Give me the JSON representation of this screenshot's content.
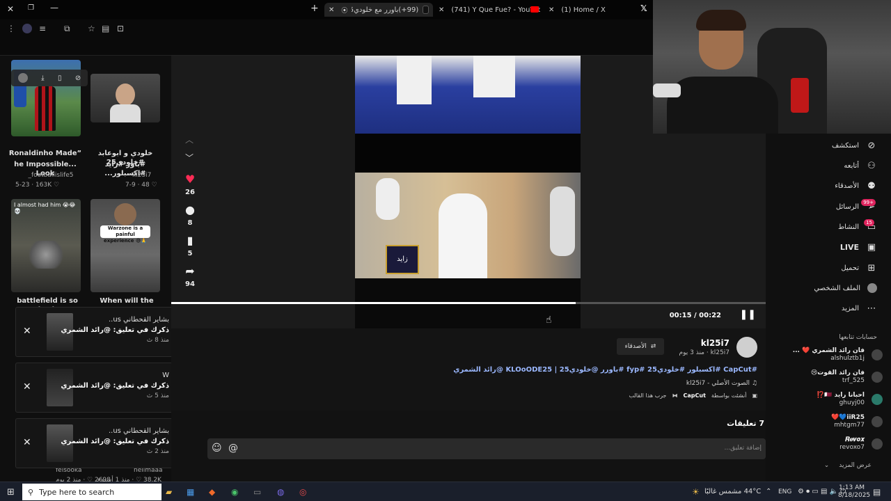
{
  "browser": {
    "tabs": [
      {
        "label": "(99+)باورر مع خلودي25 - اكت...",
        "active": true,
        "color": "#000000"
      },
      {
        "label": "(741) Y Que Fue? - YouTube",
        "active": false,
        "color": "#ff0000"
      },
      {
        "label": "(1) Home / X",
        "active": false,
        "color": "#ffffff"
      }
    ]
  },
  "feed": {
    "items": [
      {
        "title": "”Ronaldinho Made",
        "title2": "...he Impossible Look",
        "author": "_footballislife5",
        "date": "5-23",
        "likes": "163K"
      },
      {
        "title": "خلودي و ابوعابد #خلودي25",
        "title2": "#باور #زايد #اكسبلور...",
        "author": "kl25i7",
        "date": "7-9",
        "likes": "48"
      },
      {
        "title": "battlefield is so back",
        "thumb_text": "I almost had him 😭😂💀"
      },
      {
        "title": "When will the",
        "thumb_text": "Warzone is a painful experience 😅🙏"
      }
    ],
    "bottom": [
      {
        "author": "felsooka",
        "date": "منذ 2 يوم",
        "likes": "2698"
      },
      {
        "author": "neiimaaa",
        "date": "منذ 1 أسبوع",
        "likes": "38.2K"
      }
    ]
  },
  "notifications": [
    {
      "name": "بشاير القحطاني us..",
      "text": "ذكرك في تعليق: @رائد الشمري",
      "time": "منذ 8 ث"
    },
    {
      "name": "W",
      "text": "ذكرك في تعليق: @رائد الشمري",
      "time": "منذ 5 ث"
    },
    {
      "name": "بشاير القحطاني us..",
      "text": "ذكرك في تعليق: @رائد الشمري",
      "time": "منذ 2 ث"
    }
  ],
  "player": {
    "likes": "26",
    "comments": "8",
    "saves": "5",
    "shares": "94",
    "time": "00:15 / 00:22",
    "progress": 0.68,
    "overlay_text": "زايد"
  },
  "info": {
    "username": "kl25i7",
    "handle": "kl25i7",
    "when": "منذ 3 يوم",
    "friends_button": "الأصدقاء",
    "caption": "#CapCut #اكسبلور #خلودي25 #fyp #باورر @خلودي25 | KLOoODE25 @رائد الشمري",
    "sound": "الصوت الأصلي - kl25i7",
    "capcut": "CapCut",
    "template": "جرب هذا القالب",
    "created": "أنشئت بواسطة"
  },
  "comments": {
    "heading": "7 تعليقات",
    "placeholder": "إضافة تعليق..."
  },
  "nav": {
    "items": [
      {
        "label": "استكشف",
        "icon": "compass-icon"
      },
      {
        "label": "أتابعه",
        "icon": "user-plus-icon"
      },
      {
        "label": "الأصدقاء",
        "icon": "friends-icon"
      },
      {
        "label": "الرسائل",
        "icon": "send-icon",
        "badge": "99+"
      },
      {
        "label": "النشاط",
        "icon": "inbox-icon",
        "badge": "15"
      },
      {
        "label": "LIVE",
        "icon": "tv-icon"
      },
      {
        "label": "تحميل",
        "icon": "plus-square-icon"
      },
      {
        "label": "الملف الشخصي",
        "icon": "profile-icon"
      },
      {
        "label": "المزيد",
        "icon": "ellipsis-icon"
      }
    ],
    "following_heading": "حسابات تتابعها",
    "following": [
      {
        "name": "فان رائد الشمري ❤️ ...",
        "handle": "alshulztb1j"
      },
      {
        "name": "فان رائد القوت😢",
        "handle": "trf_525"
      },
      {
        "name": "احبانا رايد 🇶🇦⁉️",
        "handle": "ghuyj00"
      },
      {
        "name": "iiR25💙❤️",
        "handle": "mhtgm77"
      },
      {
        "name": "𝑹𝒆𝒗𝒐𝒙",
        "handle": "revoxo7"
      }
    ],
    "see_more": "عرض المزيد"
  },
  "taskbar": {
    "search_placeholder": "Type here to search",
    "weather": "44°C  مشمس غالبًا",
    "lang": "ENG",
    "time": "1:13 AM",
    "date": "8/18/2025"
  }
}
